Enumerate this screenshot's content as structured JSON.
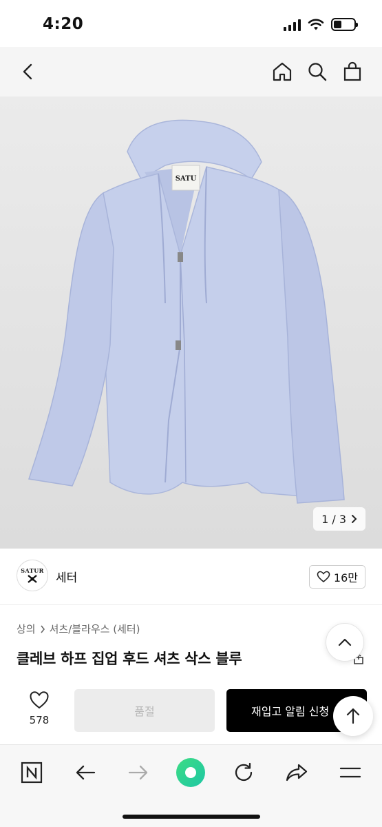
{
  "status_bar": {
    "time": "4:20"
  },
  "header": {
    "icons": [
      "back-icon",
      "home-icon",
      "search-icon",
      "shopping-bag-icon"
    ]
  },
  "hero": {
    "image_counter": "1 / 3",
    "label_text": "SATU",
    "colors": {
      "shirt": "#c3cdea",
      "shirt_shadow": "#a9b5da"
    }
  },
  "brand": {
    "logo_text": "SATUR",
    "name": "세터",
    "likes": "16만"
  },
  "product": {
    "breadcrumb": [
      "상의",
      "셔츠/블라우스 (세터)"
    ],
    "title": "클레브 하프 집업 후드 셔츠 삭스 블루"
  },
  "action_bar": {
    "wish_count": "578",
    "sold_out_label": "품절",
    "restock_label": "재입고 알림 신청"
  },
  "browser": {
    "icons": [
      "naver-n-icon",
      "back-arrow-icon",
      "forward-arrow-icon",
      "green-dot-icon",
      "reload-icon",
      "share-icon",
      "menu-icon"
    ]
  }
}
